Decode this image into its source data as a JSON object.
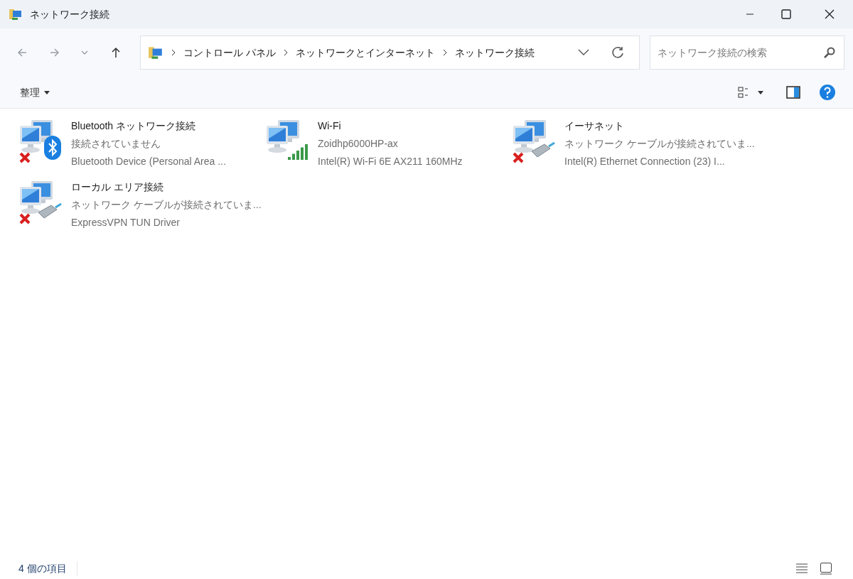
{
  "window": {
    "title": "ネットワーク接続"
  },
  "breadcrumb": [
    "コントロール パネル",
    "ネットワークとインターネット",
    "ネットワーク接続"
  ],
  "search": {
    "placeholder": "ネットワーク接続の検索"
  },
  "command_bar": {
    "organize": "整理"
  },
  "connections": [
    {
      "kind": "bluetooth",
      "disconnected": true,
      "name": "Bluetooth ネットワーク接続",
      "status": "接続されていません",
      "device": "Bluetooth Device (Personal Area ..."
    },
    {
      "kind": "wifi",
      "disconnected": false,
      "name": "Wi-Fi",
      "status": "Zoidhp6000HP-ax",
      "device": "Intel(R) Wi-Fi 6E AX211 160MHz"
    },
    {
      "kind": "ethernet",
      "disconnected": true,
      "name": "イーサネット",
      "status": "ネットワーク ケーブルが接続されていま...",
      "device": "Intel(R) Ethernet Connection (23) I..."
    },
    {
      "kind": "ethernet",
      "disconnected": true,
      "name": "ローカル エリア接続",
      "status": "ネットワーク ケーブルが接続されていま...",
      "device": "ExpressVPN TUN Driver"
    }
  ],
  "status_bar": {
    "count": "4 個の項目"
  }
}
